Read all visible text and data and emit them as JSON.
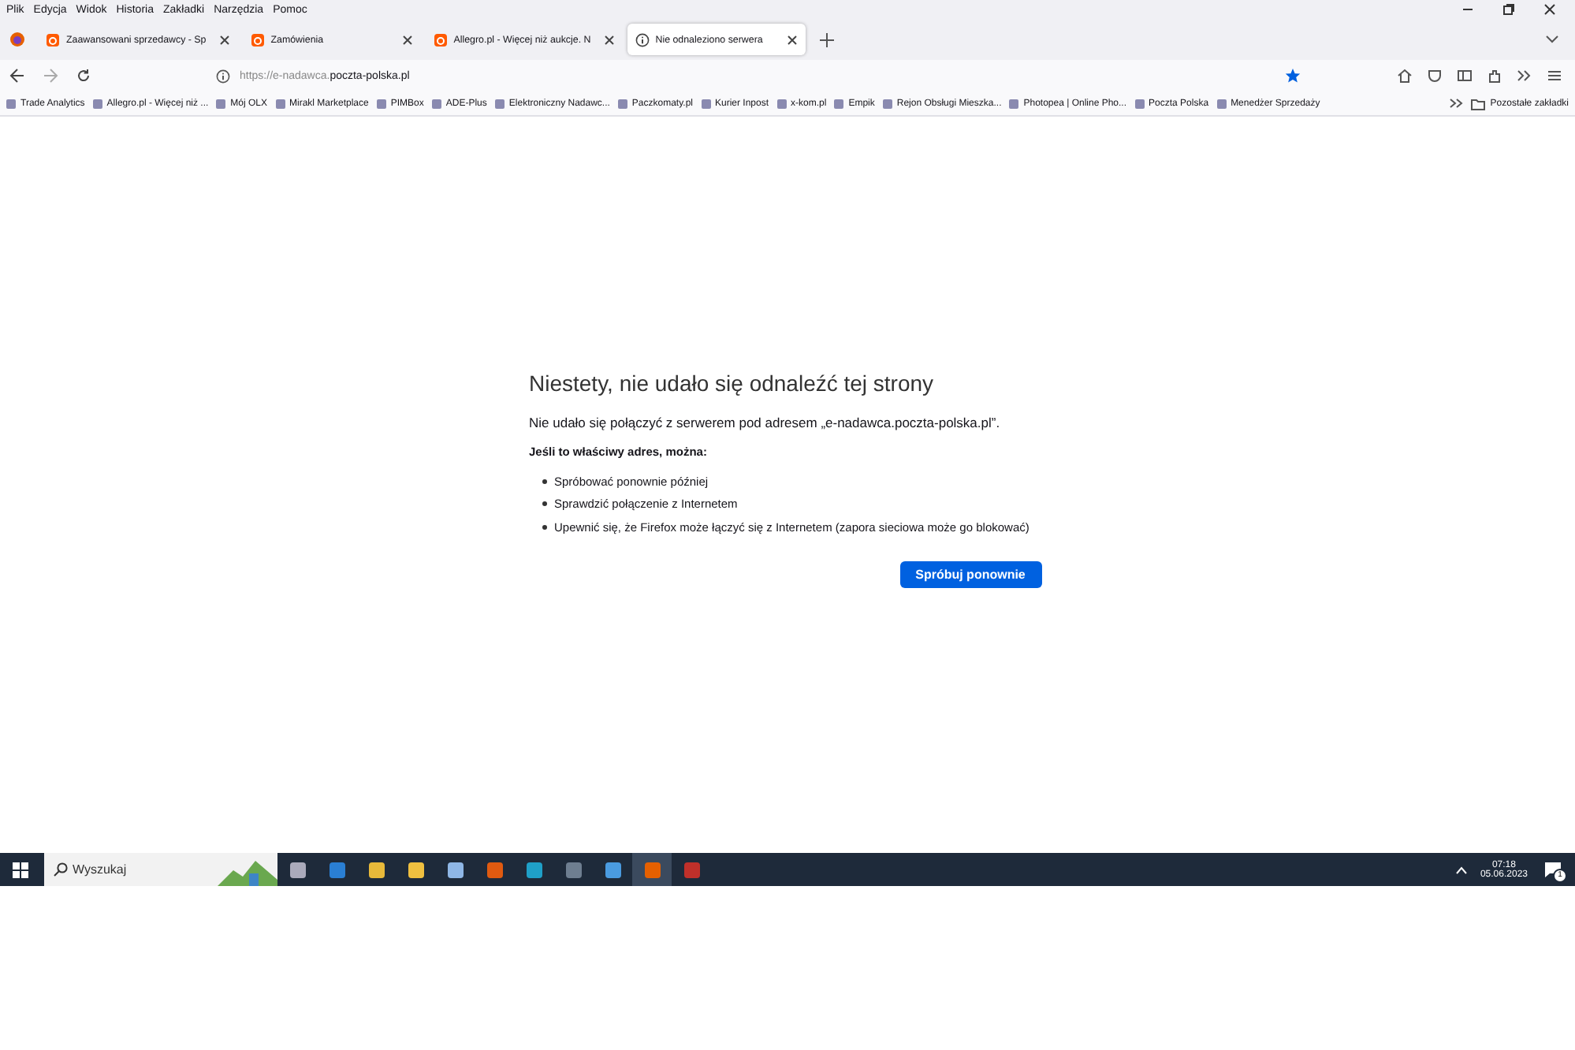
{
  "menu": [
    "Plik",
    "Edycja",
    "Widok",
    "Historia",
    "Zakładki",
    "Narzędzia",
    "Pomoc"
  ],
  "tabs": [
    {
      "title": "Zaawansowani sprzedawcy - Sp",
      "kind": "allegro",
      "selected": false
    },
    {
      "title": "Zamówienia",
      "kind": "allegro",
      "selected": false
    },
    {
      "title": "Allegro.pl - Więcej niż aukcje. N",
      "kind": "allegro",
      "selected": false
    },
    {
      "title": "Nie odnaleziono serwera",
      "kind": "info",
      "selected": true
    }
  ],
  "address": {
    "prefix": "https://e-nadawca.",
    "domain": "poczta-polska.pl"
  },
  "bookmarks": [
    "Trade Analytics",
    "Allegro.pl - Więcej niż ...",
    "Mój OLX",
    "Mirakl Marketplace",
    "PIMBox",
    "ADE-Plus",
    "Elektroniczny Nadawc...",
    "Paczkomaty.pl",
    "Kurier Inpost",
    "x-kom.pl",
    "Empik",
    "Rejon Obsługi Mieszka...",
    "Photopea | Online Pho...",
    "Poczta Polska",
    "Menedżer Sprzedaży"
  ],
  "other_bookmarks": "Pozostałe zakładki",
  "error": {
    "title": "Niestety, nie udało się odnaleźć tej strony",
    "message": "Nie udało się połączyć z serwerem pod adresem „e-nadawca.poczta-polska.pl”.",
    "subtitle": "Jeśli to właściwy adres, można:",
    "suggestions": [
      "Spróbować ponownie później",
      "Sprawdzić połączenie z Internetem",
      "Upewnić się, że Firefox może łączyć się z Internetem (zapora sieciowa może go blokować)"
    ],
    "button": "Spróbuj ponownie"
  },
  "taskbar": {
    "search_placeholder": "Wyszukaj",
    "time": "07:18",
    "date": "05.06.2023",
    "notification_count": "1"
  }
}
